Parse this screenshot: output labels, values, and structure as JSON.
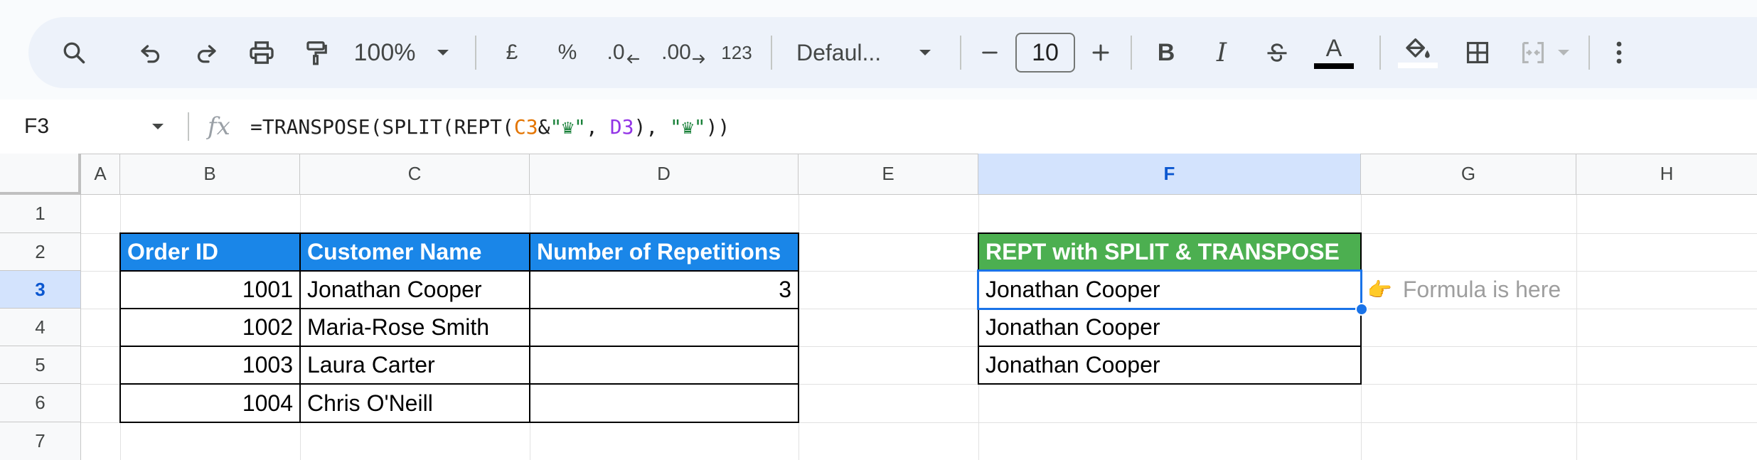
{
  "toolbar": {
    "zoom": "100%",
    "currency_label": "£",
    "percent_label": "%",
    "decrease_decimal_label": ".0",
    "increase_decimal_label": ".00",
    "number_format_label": "123",
    "font_name": "Defaul...",
    "font_size": "10",
    "bold_label": "B",
    "italic_label": "I",
    "text_color_label": "A"
  },
  "formula_bar": {
    "name_box": "F3",
    "fx": "fx",
    "formula_parts": {
      "p1": "=TRANSPOSE(SPLIT(REPT(",
      "ref1": "C3",
      "p2": "&",
      "str1": "\"♛\"",
      "p3": ", ",
      "ref2": "D3",
      "p4": "), ",
      "str2": "\"♛\"",
      "p5": "))"
    }
  },
  "columns": [
    "A",
    "B",
    "C",
    "D",
    "E",
    "F",
    "G",
    "H"
  ],
  "rows": [
    "1",
    "2",
    "3",
    "4",
    "5",
    "6",
    "7"
  ],
  "table": {
    "headers": [
      "Order ID",
      "Customer Name",
      "Number of Repetitions"
    ],
    "rows": [
      {
        "order_id": "1001",
        "customer": "Jonathan Cooper",
        "reps": "3"
      },
      {
        "order_id": "1002",
        "customer": "Maria-Rose Smith",
        "reps": ""
      },
      {
        "order_id": "1003",
        "customer": "Laura Carter",
        "reps": ""
      },
      {
        "order_id": "1004",
        "customer": "Chris O'Neill",
        "reps": ""
      }
    ]
  },
  "result": {
    "header": "REPT with SPLIT & TRANSPOSE",
    "values": [
      "Jonathan Cooper",
      "Jonathan Cooper",
      "Jonathan Cooper"
    ]
  },
  "note": {
    "emoji": "👈",
    "text": "Formula is here"
  },
  "colors": {
    "header_blue": "#1a86e8",
    "header_green": "#4caf50",
    "selection": "#1a73e8",
    "selected_header_bg": "#d3e3fd"
  }
}
